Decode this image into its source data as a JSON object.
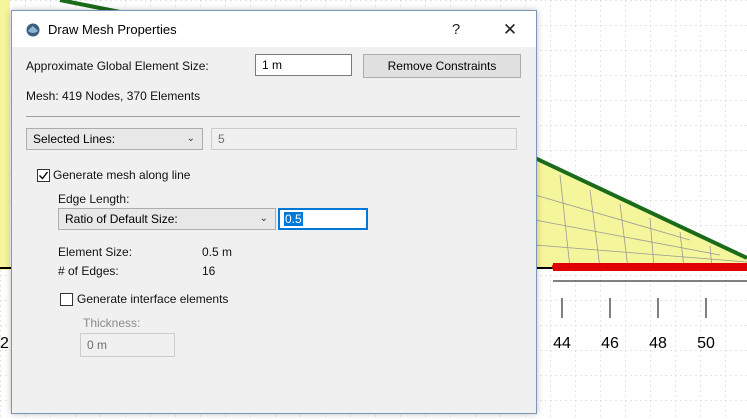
{
  "dialog": {
    "title": "Draw Mesh Properties",
    "help_label": "?",
    "close_label": "✕",
    "global_size_label": "Approximate Global Element Size:",
    "global_size_value": "1 m",
    "remove_constraints_label": "Remove Constraints",
    "mesh_info": "Mesh:  419 Nodes, 370 Elements",
    "selection_type": "Selected Lines:",
    "selected_count": "5",
    "generate_mesh": {
      "label": "Generate mesh along line",
      "checked": true
    },
    "edge_length_label": "Edge Length:",
    "edge_length_mode": "Ratio of Default Size:",
    "ratio_value": "0.5",
    "element_size_label": "Element Size:",
    "element_size_value": "0.5 m",
    "edges_label": "# of Edges:",
    "edges_value": "16",
    "interface": {
      "label": "Generate interface elements",
      "checked": false
    },
    "thickness_label": "Thickness:",
    "thickness_value": "0 m"
  },
  "background": {
    "axis_ticks": [
      "44",
      "46",
      "48",
      "50"
    ],
    "partial_tick": "2",
    "colors": {
      "mesh_fill": "#f5f59b",
      "boundary": "#1a6b1a",
      "constraint_nodes": "#e00000",
      "grid": "#c8c8c8"
    }
  }
}
